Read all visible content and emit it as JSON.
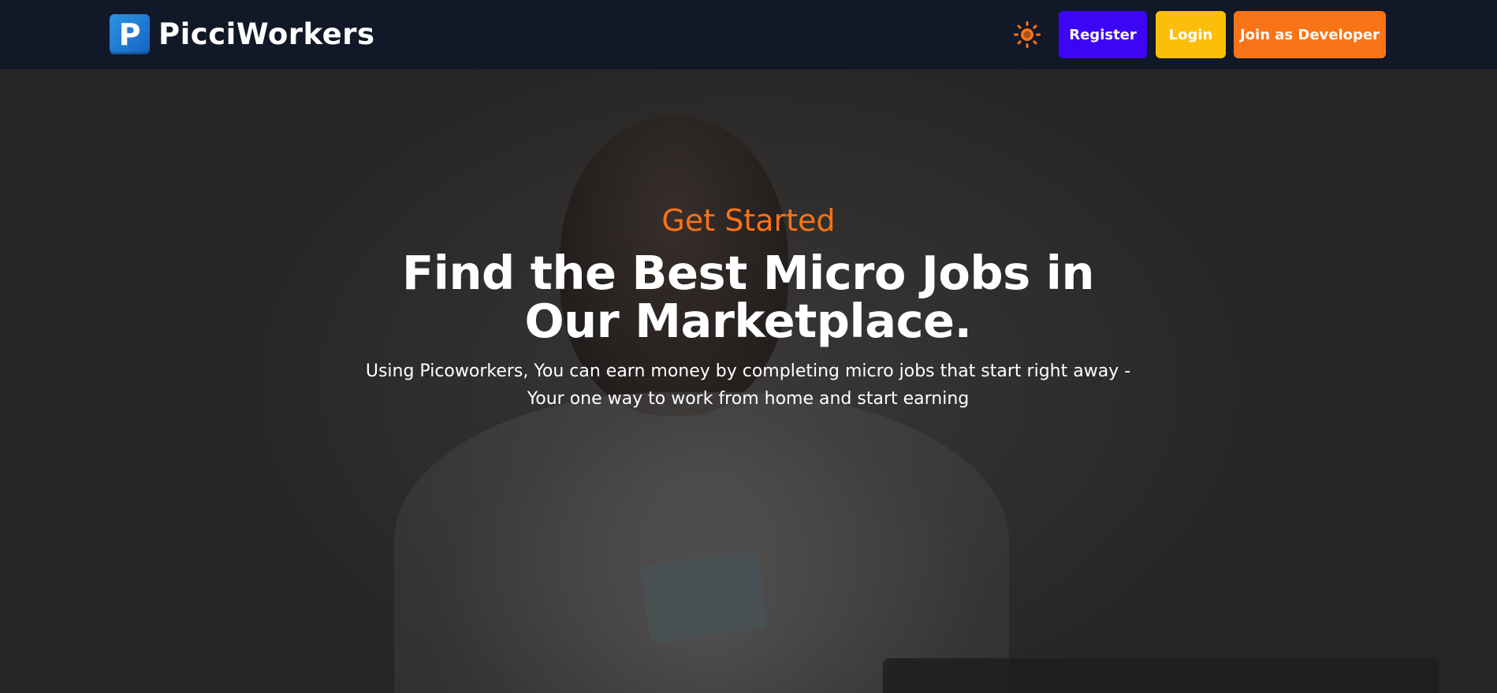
{
  "brand": {
    "logo_letter": "P",
    "name": "PicciWorkers"
  },
  "nav": {
    "theme_toggle_icon": "sun-icon",
    "register_label": "Register",
    "login_label": "Login",
    "developer_label": "Join as Developer"
  },
  "hero": {
    "eyebrow": "Get Started",
    "headline": "Find the Best Micro Jobs in Our Marketplace.",
    "subtext": "Using Picoworkers, You can earn money by completing micro jobs that start right away - Your one way to work from home and start earning"
  },
  "colors": {
    "navbar_bg": "#111827",
    "register": "#3d05f5",
    "login": "#fbbf09",
    "developer": "#f97417",
    "accent_orange": "#f97316"
  }
}
